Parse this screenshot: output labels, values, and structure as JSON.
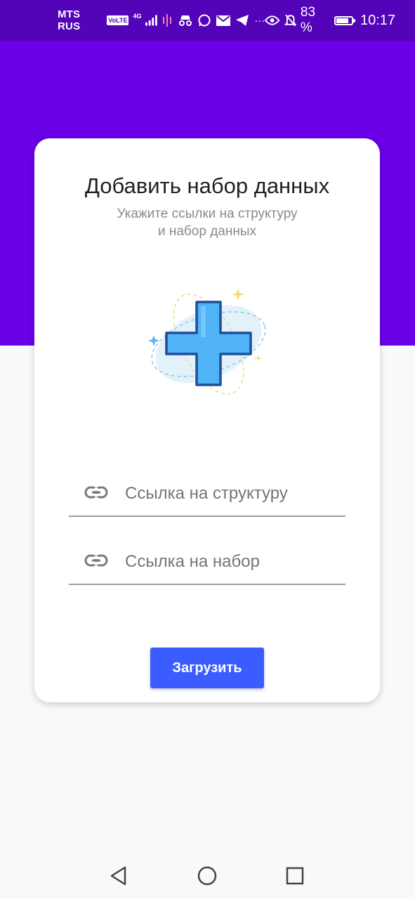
{
  "status_bar": {
    "carrier": "MTS RUS",
    "volte": "VoLTE",
    "network": "4G",
    "battery_percent": "83 %",
    "battery_level": 0.83,
    "time": "10:17",
    "more": "···"
  },
  "card": {
    "title": "Добавить набор данных",
    "subtitle_line1": "Укажите ссылки на структуру",
    "subtitle_line2": "и набор данных"
  },
  "fields": {
    "structure_link": {
      "value": "",
      "placeholder": "Ссылка на структуру"
    },
    "dataset_link": {
      "value": "",
      "placeholder": "Ссылка на набор"
    }
  },
  "submit_label": "Загрузить",
  "colors": {
    "status_bar": "#5303b8",
    "header_band": "#6a00e6",
    "accent_button": "#3b5cff",
    "plus_fill": "#4fb3f6"
  },
  "nav": {
    "back": "back-icon",
    "home": "home-icon",
    "recents": "recents-icon"
  }
}
